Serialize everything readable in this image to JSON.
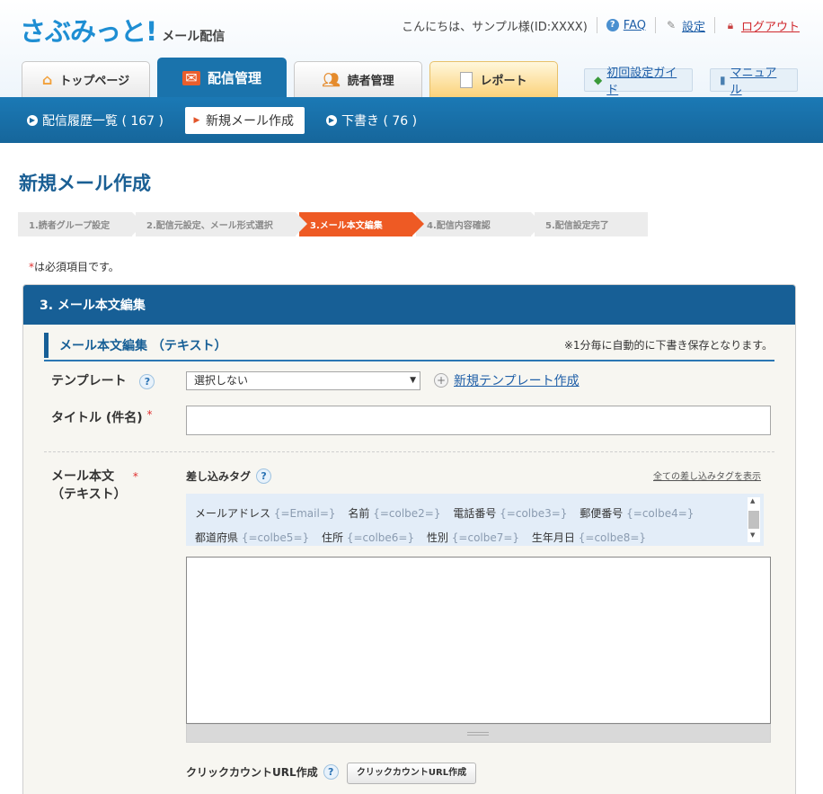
{
  "header": {
    "logo_text": "さぶみっと!",
    "logo_sub": "メール配信",
    "greeting": "こんにちは、サンプル様(ID:XXXX)",
    "faq": "FAQ",
    "settings": "設定",
    "logout": "ログアウト"
  },
  "tabs": [
    {
      "label": "トップページ"
    },
    {
      "label": "配信管理"
    },
    {
      "label": "読者管理"
    },
    {
      "label": "レポート"
    }
  ],
  "guides": {
    "initial_guide": "初回設定ガイド",
    "manual": "マニュアル"
  },
  "subnav": [
    {
      "label": "配信履歴一覧 ( 167 )"
    },
    {
      "label": "新規メール作成"
    },
    {
      "label": "下書き ( 76 )"
    }
  ],
  "page_title": "新規メール作成",
  "steps": [
    "1.読者グループ設定",
    "2.配信元設定、メール形式選択",
    "3.メール本文編集",
    "4.配信内容確認",
    "5.配信設定完了"
  ],
  "required_note": {
    "mark": "*",
    "text": "は必須項目です。"
  },
  "panel": {
    "title": "3. メール本文編集",
    "section_title": "メール本文編集 （テキスト）",
    "autosave_note": "※1分毎に自動的に下書き保存となります。"
  },
  "form": {
    "template_label": "テンプレート",
    "template_value": "選択しない",
    "new_template": "新規テンプレート作成",
    "title_label": "タイトル (件名)",
    "body_label_1": "メール本文",
    "body_label_2": "（テキスト）",
    "tag_label": "差し込みタグ",
    "show_all_tags": "全ての差し込みタグを表示",
    "click_count_label": "クリックカウントURL作成",
    "click_count_button": "クリックカウントURL作成",
    "help": "?",
    "required_mark": "*"
  },
  "tags_row1": [
    {
      "name": "メールアドレス",
      "tag": "{=Email=}"
    },
    {
      "name": "名前",
      "tag": "{=colbe2=}"
    },
    {
      "name": "電話番号",
      "tag": "{=colbe3=}"
    },
    {
      "name": "郵便番号",
      "tag": "{=colbe4=}"
    }
  ],
  "tags_row2": [
    {
      "name": "都道府県",
      "tag": "{=colbe5=}"
    },
    {
      "name": "住所",
      "tag": "{=colbe6=}"
    },
    {
      "name": "性別",
      "tag": "{=colbe7=}"
    },
    {
      "name": "生年月日",
      "tag": "{=colbe8=}"
    }
  ]
}
